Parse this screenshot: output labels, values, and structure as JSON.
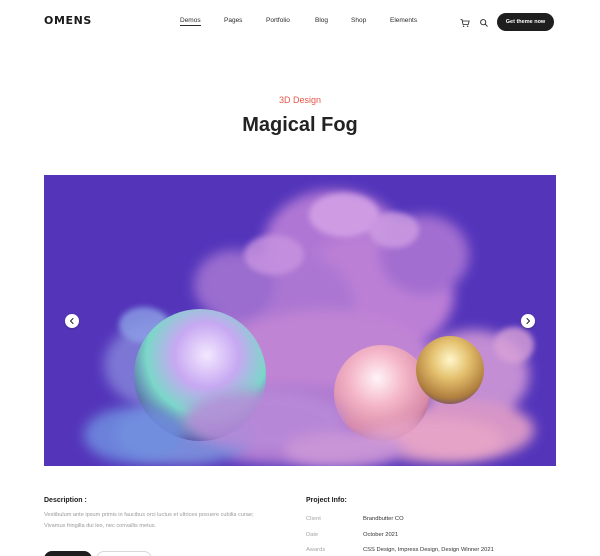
{
  "header": {
    "logo": "OMENS",
    "nav": [
      "Demos",
      "Pages",
      "Portfolio",
      "Blog",
      "Shop",
      "Elements"
    ],
    "active_nav": "Demos",
    "cta_label": "Get theme now",
    "icons": [
      "cart-icon",
      "search-icon"
    ]
  },
  "project": {
    "category": "3D Design",
    "title": "Magical Fog"
  },
  "slider": {
    "prev_icon": "chevron-left-icon",
    "next_icon": "chevron-right-icon"
  },
  "description": {
    "heading": "Description :",
    "text": "Vestibulum ante ipsum primis in faucibus orci luctus et ultrices posuere cubilia curae; Vivamus fringilla dui leo, nec convallis metus."
  },
  "project_info": {
    "heading": "Project Info:",
    "rows": [
      {
        "label": "Client",
        "value": "Brandbutter CO"
      },
      {
        "label": "Date",
        "value": "October 2021"
      },
      {
        "label": "Awards",
        "value": "CSS Design, Impress Design, Design Winner 2021"
      }
    ]
  },
  "colors": {
    "accent": "#e8574a",
    "hero_background": "#5435ba",
    "button_dark": "#1e1e1e"
  }
}
